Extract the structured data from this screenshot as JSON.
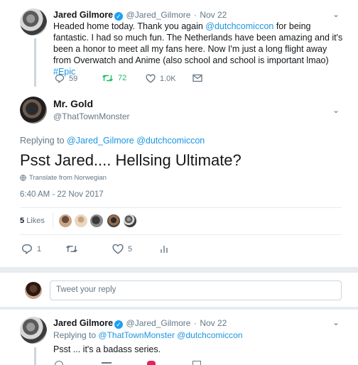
{
  "tweet1": {
    "name": "Jared Gilmore",
    "handle": "@Jared_Gilmore",
    "sep": "·",
    "date": "Nov 22",
    "text_before": "Headed home today. Thank you again ",
    "mention": "@dutchcomiccon",
    "text_middle": " for being fantastic. I had so much fun. The Netherlands have been amazing and it's been a honor to meet all my fans here. Now I'm just a long flight away from Overwatch and Anime (also school and school is important lmao) ",
    "hashtag": "#Epic",
    "replies": "59",
    "retweets": "72",
    "likes": "1.0K"
  },
  "main_tweet": {
    "name": "Mr. Gold",
    "handle": "@ThatTownMonster",
    "replying_to_label": "Replying to",
    "reply_mention_1": "@Jared_Gilmore",
    "reply_mention_2": "@dutchcomiccon",
    "text": "Psst Jared.... Hellsing Ultimate?",
    "translate": "Translate from Norwegian",
    "timestamp": "6:40 AM - 22 Nov 2017",
    "likes_count": "5",
    "likes_label": "Likes",
    "replies": "1",
    "retweets": "",
    "hearts": "5"
  },
  "reply_box": {
    "placeholder": "Tweet your reply"
  },
  "tweet3": {
    "name": "Jared Gilmore",
    "handle": "@Jared_Gilmore",
    "sep": "·",
    "date": "Nov 22",
    "replying_to_label": "Replying to",
    "reply_mention_1": "@ThatTownMonster",
    "reply_mention_2": "@dutchcomiccon",
    "text": "Psst ... it's a badass series."
  },
  "colors": {
    "link": "#1b95e0",
    "retweet": "#17bf63",
    "muted": "#657786",
    "divider": "#e6ecf0"
  },
  "icons": [
    "reply-icon",
    "retweet-icon",
    "heart-icon",
    "dm-icon",
    "analytics-icon",
    "globe-icon",
    "verified-icon",
    "chevron-down-icon"
  ]
}
